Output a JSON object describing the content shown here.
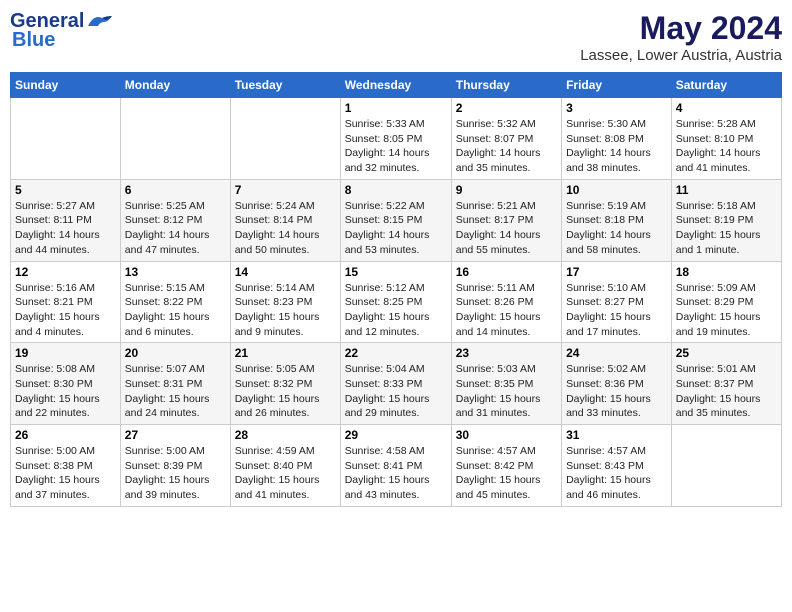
{
  "logo": {
    "line1": "General",
    "line2": "Blue"
  },
  "title": "May 2024",
  "subtitle": "Lassee, Lower Austria, Austria",
  "weekdays": [
    "Sunday",
    "Monday",
    "Tuesday",
    "Wednesday",
    "Thursday",
    "Friday",
    "Saturday"
  ],
  "weeks": [
    [
      {
        "num": "",
        "info": ""
      },
      {
        "num": "",
        "info": ""
      },
      {
        "num": "",
        "info": ""
      },
      {
        "num": "1",
        "info": "Sunrise: 5:33 AM\nSunset: 8:05 PM\nDaylight: 14 hours\nand 32 minutes."
      },
      {
        "num": "2",
        "info": "Sunrise: 5:32 AM\nSunset: 8:07 PM\nDaylight: 14 hours\nand 35 minutes."
      },
      {
        "num": "3",
        "info": "Sunrise: 5:30 AM\nSunset: 8:08 PM\nDaylight: 14 hours\nand 38 minutes."
      },
      {
        "num": "4",
        "info": "Sunrise: 5:28 AM\nSunset: 8:10 PM\nDaylight: 14 hours\nand 41 minutes."
      }
    ],
    [
      {
        "num": "5",
        "info": "Sunrise: 5:27 AM\nSunset: 8:11 PM\nDaylight: 14 hours\nand 44 minutes."
      },
      {
        "num": "6",
        "info": "Sunrise: 5:25 AM\nSunset: 8:12 PM\nDaylight: 14 hours\nand 47 minutes."
      },
      {
        "num": "7",
        "info": "Sunrise: 5:24 AM\nSunset: 8:14 PM\nDaylight: 14 hours\nand 50 minutes."
      },
      {
        "num": "8",
        "info": "Sunrise: 5:22 AM\nSunset: 8:15 PM\nDaylight: 14 hours\nand 53 minutes."
      },
      {
        "num": "9",
        "info": "Sunrise: 5:21 AM\nSunset: 8:17 PM\nDaylight: 14 hours\nand 55 minutes."
      },
      {
        "num": "10",
        "info": "Sunrise: 5:19 AM\nSunset: 8:18 PM\nDaylight: 14 hours\nand 58 minutes."
      },
      {
        "num": "11",
        "info": "Sunrise: 5:18 AM\nSunset: 8:19 PM\nDaylight: 15 hours\nand 1 minute."
      }
    ],
    [
      {
        "num": "12",
        "info": "Sunrise: 5:16 AM\nSunset: 8:21 PM\nDaylight: 15 hours\nand 4 minutes."
      },
      {
        "num": "13",
        "info": "Sunrise: 5:15 AM\nSunset: 8:22 PM\nDaylight: 15 hours\nand 6 minutes."
      },
      {
        "num": "14",
        "info": "Sunrise: 5:14 AM\nSunset: 8:23 PM\nDaylight: 15 hours\nand 9 minutes."
      },
      {
        "num": "15",
        "info": "Sunrise: 5:12 AM\nSunset: 8:25 PM\nDaylight: 15 hours\nand 12 minutes."
      },
      {
        "num": "16",
        "info": "Sunrise: 5:11 AM\nSunset: 8:26 PM\nDaylight: 15 hours\nand 14 minutes."
      },
      {
        "num": "17",
        "info": "Sunrise: 5:10 AM\nSunset: 8:27 PM\nDaylight: 15 hours\nand 17 minutes."
      },
      {
        "num": "18",
        "info": "Sunrise: 5:09 AM\nSunset: 8:29 PM\nDaylight: 15 hours\nand 19 minutes."
      }
    ],
    [
      {
        "num": "19",
        "info": "Sunrise: 5:08 AM\nSunset: 8:30 PM\nDaylight: 15 hours\nand 22 minutes."
      },
      {
        "num": "20",
        "info": "Sunrise: 5:07 AM\nSunset: 8:31 PM\nDaylight: 15 hours\nand 24 minutes."
      },
      {
        "num": "21",
        "info": "Sunrise: 5:05 AM\nSunset: 8:32 PM\nDaylight: 15 hours\nand 26 minutes."
      },
      {
        "num": "22",
        "info": "Sunrise: 5:04 AM\nSunset: 8:33 PM\nDaylight: 15 hours\nand 29 minutes."
      },
      {
        "num": "23",
        "info": "Sunrise: 5:03 AM\nSunset: 8:35 PM\nDaylight: 15 hours\nand 31 minutes."
      },
      {
        "num": "24",
        "info": "Sunrise: 5:02 AM\nSunset: 8:36 PM\nDaylight: 15 hours\nand 33 minutes."
      },
      {
        "num": "25",
        "info": "Sunrise: 5:01 AM\nSunset: 8:37 PM\nDaylight: 15 hours\nand 35 minutes."
      }
    ],
    [
      {
        "num": "26",
        "info": "Sunrise: 5:00 AM\nSunset: 8:38 PM\nDaylight: 15 hours\nand 37 minutes."
      },
      {
        "num": "27",
        "info": "Sunrise: 5:00 AM\nSunset: 8:39 PM\nDaylight: 15 hours\nand 39 minutes."
      },
      {
        "num": "28",
        "info": "Sunrise: 4:59 AM\nSunset: 8:40 PM\nDaylight: 15 hours\nand 41 minutes."
      },
      {
        "num": "29",
        "info": "Sunrise: 4:58 AM\nSunset: 8:41 PM\nDaylight: 15 hours\nand 43 minutes."
      },
      {
        "num": "30",
        "info": "Sunrise: 4:57 AM\nSunset: 8:42 PM\nDaylight: 15 hours\nand 45 minutes."
      },
      {
        "num": "31",
        "info": "Sunrise: 4:57 AM\nSunset: 8:43 PM\nDaylight: 15 hours\nand 46 minutes."
      },
      {
        "num": "",
        "info": ""
      }
    ]
  ]
}
